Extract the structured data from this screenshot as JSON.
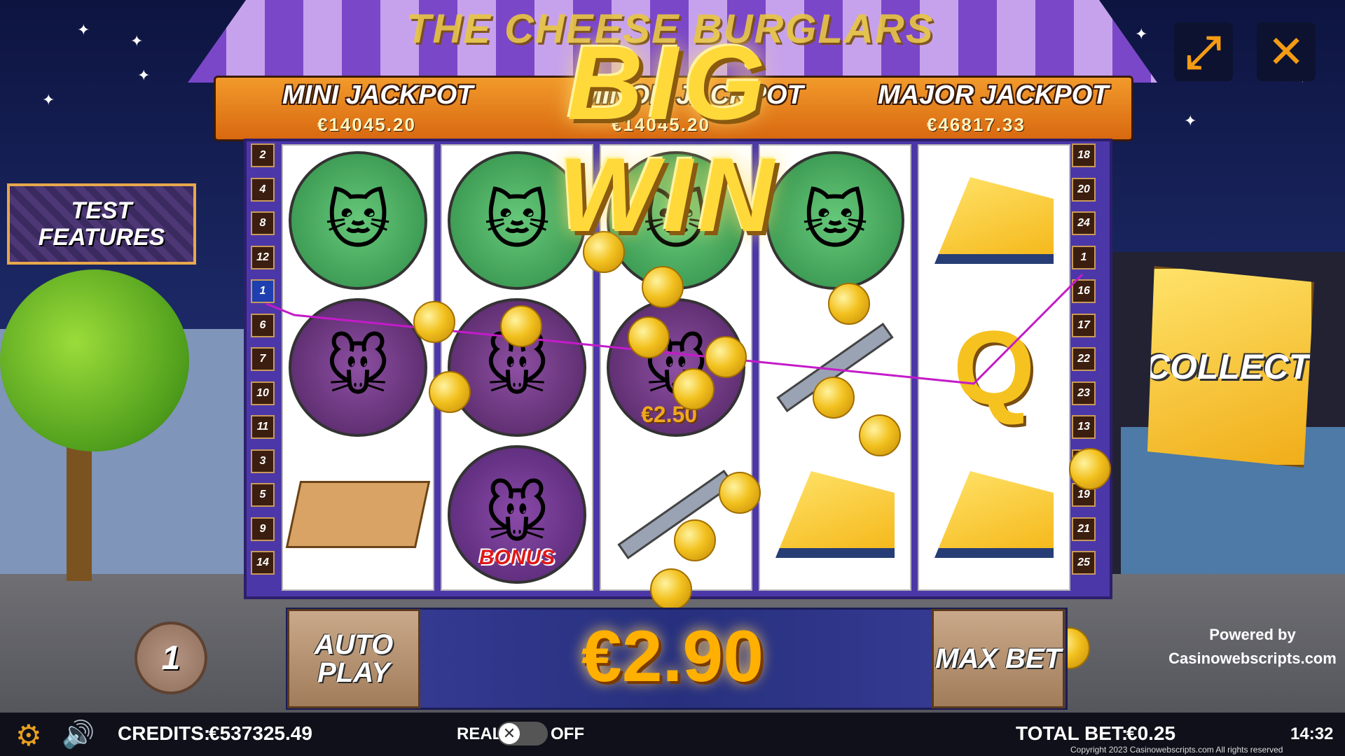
{
  "game": {
    "title_art": "THE CHEESE BURGLARS",
    "big_win": "BIG WIN",
    "jackpots": {
      "mini": {
        "label": "MINI JACKPOT",
        "value": "€14045.20"
      },
      "minor": {
        "label": "MINOR JACKPOT",
        "value": "€14045.20"
      },
      "major": {
        "label": "MAJOR JACKPOT",
        "value": "€46817.33"
      }
    },
    "paylines_left": [
      "2",
      "4",
      "8",
      "12",
      "1",
      "6",
      "7",
      "10",
      "11",
      "3",
      "5",
      "9",
      "14"
    ],
    "paylines_right": [
      "18",
      "20",
      "24",
      "1",
      "16",
      "17",
      "22",
      "23",
      "13",
      "15",
      "19",
      "21",
      "25"
    ],
    "reels": [
      [
        "cop-cat",
        "burglar-mouse",
        "mousetrap"
      ],
      [
        "cop-cat",
        "burglar-mouse",
        "bonus-mouse"
      ],
      [
        "cop-cat",
        "burglar-mouse",
        "tweezers"
      ],
      [
        "cop-cat",
        "tweezers",
        "cheese"
      ],
      [
        "cheese",
        "Q",
        "cheese"
      ]
    ],
    "bonus_label": "BONUS",
    "symbol_win": "€2.50",
    "test_features": "TEST FEATURES",
    "collect": "COLLECT",
    "auto_play": "AUTO PLAY",
    "max_bet": "MAX BET",
    "win_amount": "€2.90",
    "lines": "1",
    "powered_by": "Powered by",
    "powered_site": "Casinowebscripts.com"
  },
  "status_bar": {
    "credits_label": "CREDITS:",
    "credits_value": "€537325.49",
    "real_label": "REAL",
    "off_label": "OFF",
    "total_bet_label": "TOTAL BET:",
    "total_bet_value": "€0.25",
    "time": "14:32",
    "copyright": "Copyright 2023 Casinowebscripts.com All rights reserved"
  },
  "icons": {
    "fullscreen": "expand-arrows-icon",
    "close": "close-icon",
    "settings": "gear-icon",
    "sound": "speaker-icon"
  },
  "colors": {
    "accent_orange": "#f49b14",
    "win_gold": "#ffb000",
    "reel_frame": "#4c37a8",
    "payline": "#c41bc9"
  }
}
